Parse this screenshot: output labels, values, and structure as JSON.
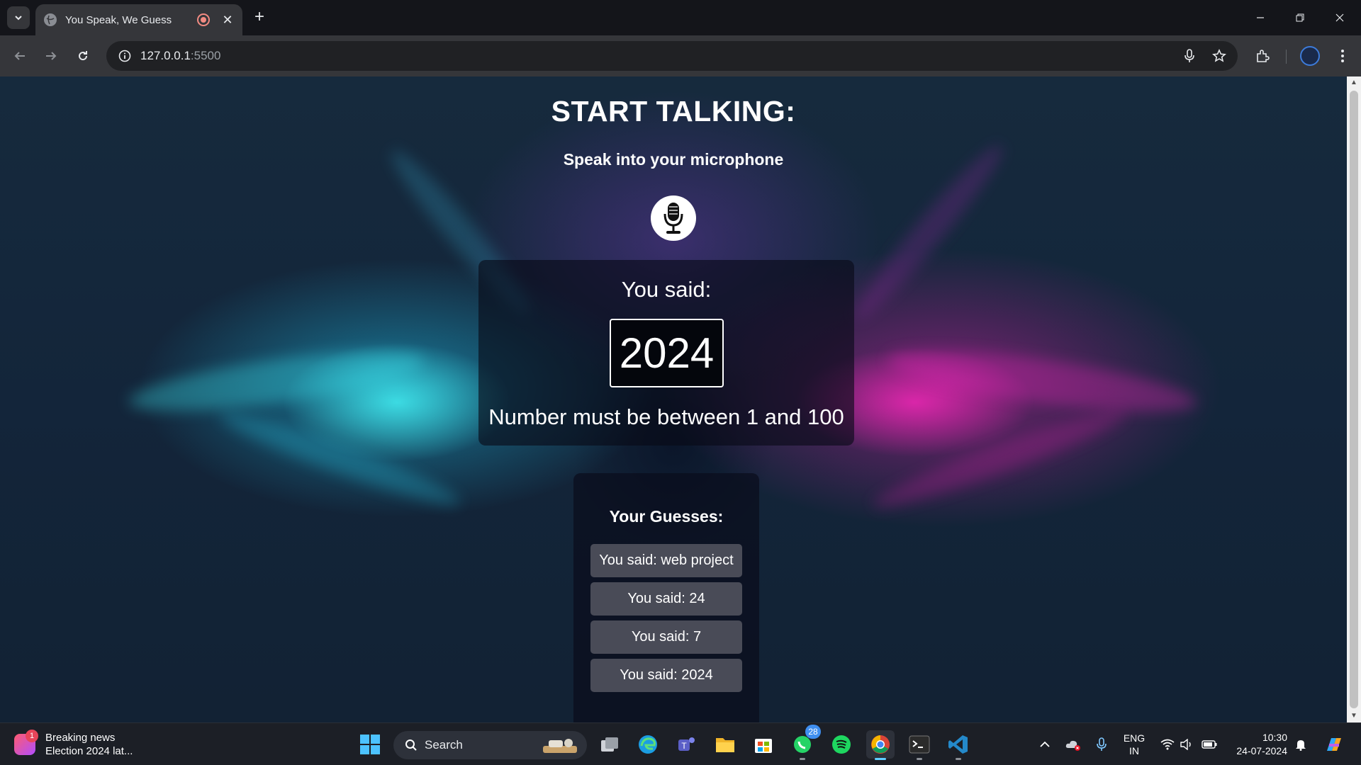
{
  "browser": {
    "tab_title": "You Speak, We Guess",
    "url_host": "127.0.0.1",
    "url_port": ":5500"
  },
  "page": {
    "title": "START TALKING:",
    "subtitle": "Speak into your microphone",
    "said_label": "You said:",
    "said_value": "2024",
    "said_message": "Number must be between 1 and 100",
    "guesses_title": "Your Guesses:",
    "guesses": [
      "You said: web project",
      "You said: 24",
      "You said: 7",
      "You said: 2024"
    ]
  },
  "taskbar": {
    "news_title": "Breaking news",
    "news_subtitle": "Election 2024 lat...",
    "news_badge": "1",
    "search_placeholder": "Search",
    "whatsapp_badge": "28",
    "lang_line1": "ENG",
    "lang_line2": "IN",
    "time": "10:30",
    "date": "24-07-2024"
  },
  "colors": {
    "accent_cyan": "#48ffff",
    "accent_magenta": "#ff28be",
    "guess_item_bg": "#494b57"
  }
}
